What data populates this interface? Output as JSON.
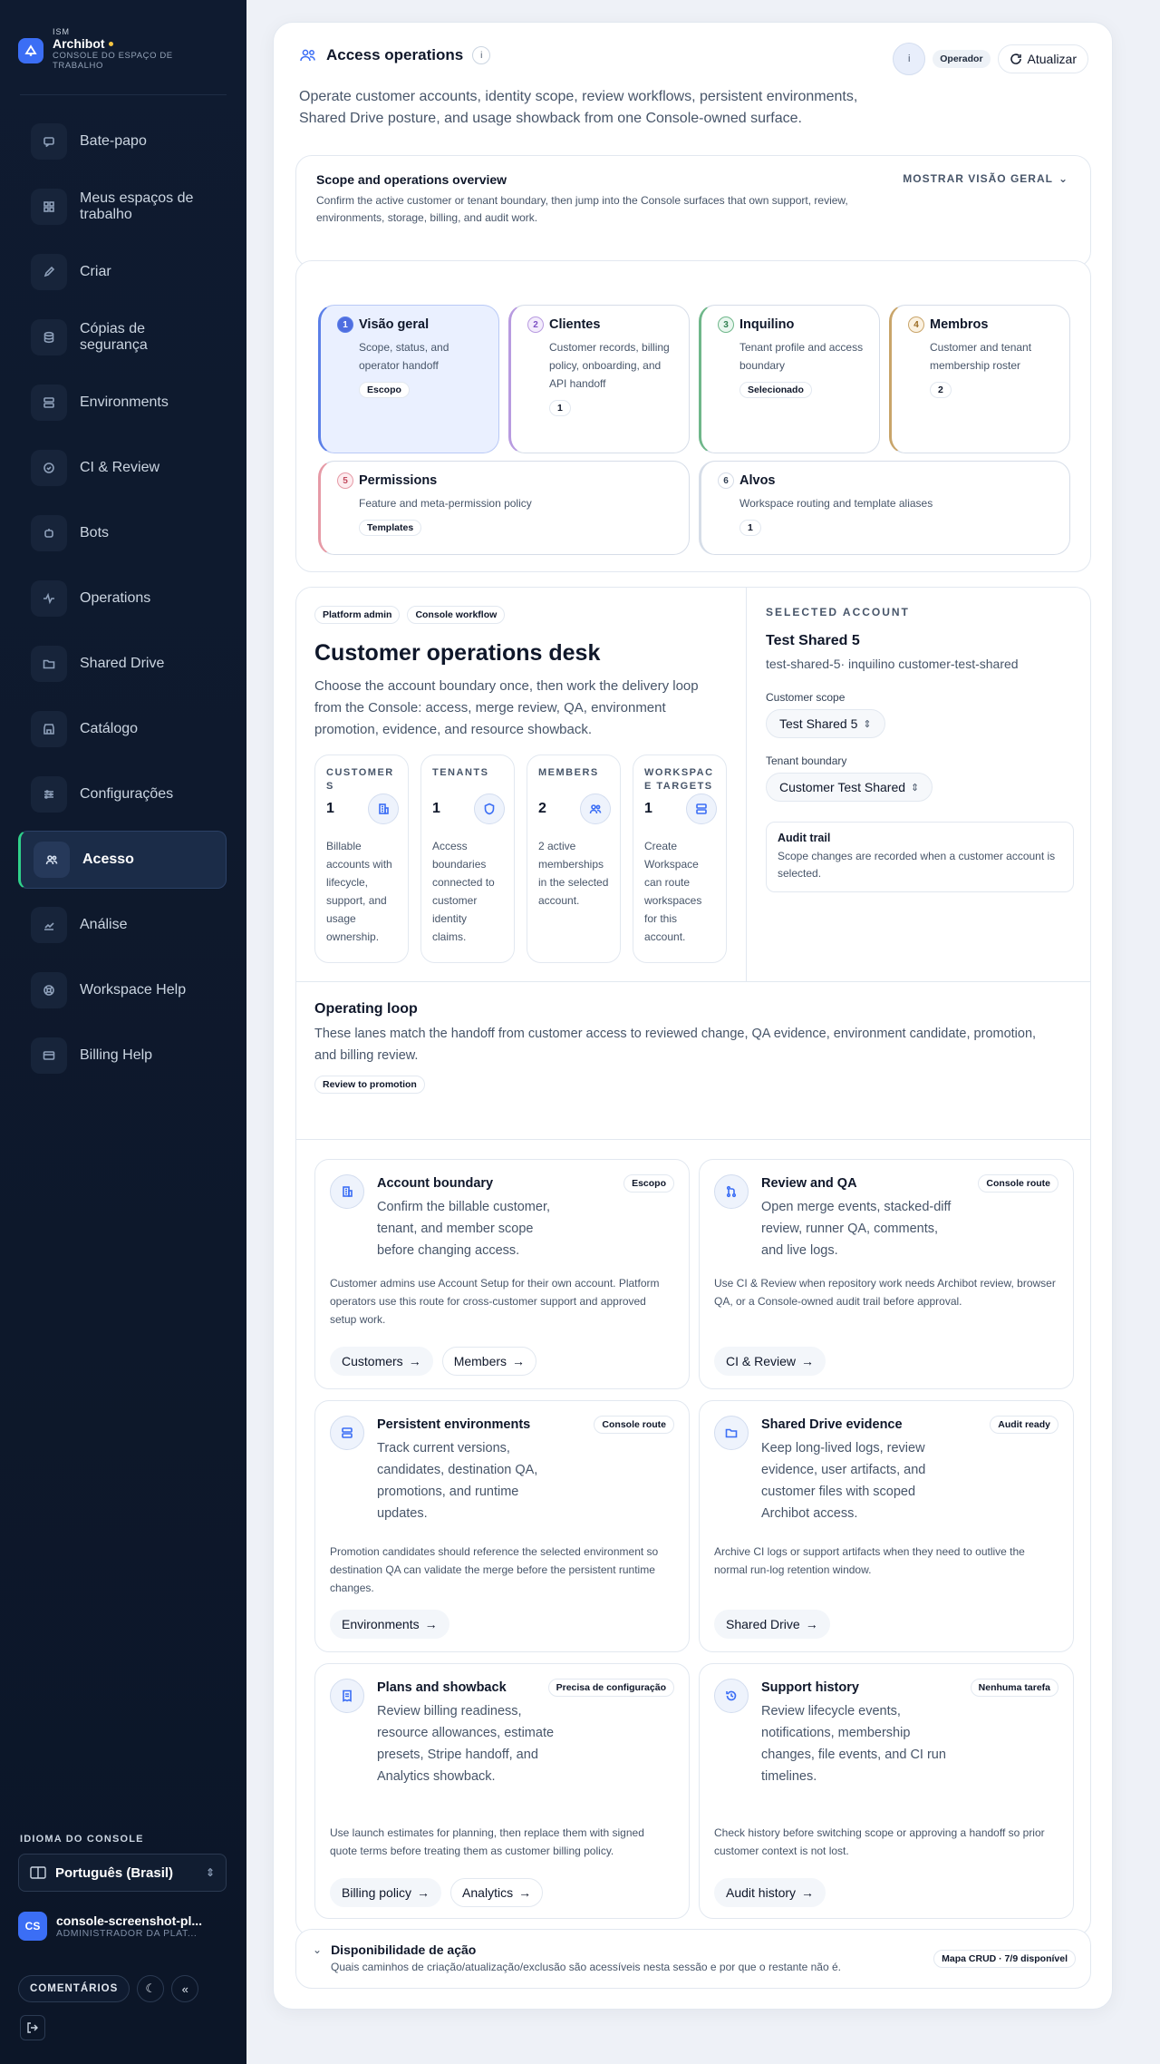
{
  "sidebar": {
    "brand_small": "ISM",
    "brand_name": "Archibot",
    "brand_sub": "CONSOLE DO ESPAÇO DE TRABALHO",
    "items": [
      {
        "label": "Bate-papo",
        "icon": "chat-icon"
      },
      {
        "label": "Meus espaços de trabalho",
        "icon": "grid-icon"
      },
      {
        "label": "Criar",
        "icon": "pencil-icon"
      },
      {
        "label": "Cópias de segurança",
        "icon": "database-icon"
      },
      {
        "label": "Environments",
        "icon": "server-icon"
      },
      {
        "label": "CI & Review",
        "icon": "check-circle-icon"
      },
      {
        "label": "Bots",
        "icon": "bot-icon"
      },
      {
        "label": "Operations",
        "icon": "pulse-icon"
      },
      {
        "label": "Shared Drive",
        "icon": "folder-icon"
      },
      {
        "label": "Catálogo",
        "icon": "store-icon"
      },
      {
        "label": "Configurações",
        "icon": "sliders-icon"
      },
      {
        "label": "Acesso",
        "icon": "users-icon",
        "active": true
      },
      {
        "label": "Análise",
        "icon": "chart-icon"
      },
      {
        "label": "Workspace Help",
        "icon": "lifebuoy-icon"
      },
      {
        "label": "Billing Help",
        "icon": "card-icon"
      }
    ],
    "lang_label": "IDIOMA DO CONSOLE",
    "lang_value": "Português (Brasil)",
    "user_initials": "CS",
    "user_name": "console-screenshot-pl...",
    "user_role": "ADMINISTRADOR DA PLAT...",
    "feedback": "COMENTÁRIOS",
    "accent": "#2fd18b"
  },
  "header": {
    "title": "Access operations",
    "info": "i",
    "avatar_letter": "i",
    "role_chip": "Operador",
    "refresh": "Atualizar",
    "intro": "Operate customer accounts, identity scope, review workflows, persistent environments, Shared Drive posture, and usage showback from one Console-owned surface."
  },
  "overview": {
    "title": "Scope and operations overview",
    "desc": "Confirm the active customer or tenant boundary, then jump into the Console surfaces that own support, review, environments, storage, billing, and audit work.",
    "toggle": "MOSTRAR VISÃO GERAL"
  },
  "steps": [
    {
      "num": "1",
      "title": "Visão geral",
      "desc": "Scope, status, and operator handoff",
      "badge": "Escopo"
    },
    {
      "num": "2",
      "title": "Clientes",
      "desc": "Customer records, billing policy, onboarding, and API handoff",
      "badge": "1"
    },
    {
      "num": "3",
      "title": "Inquilino",
      "desc": "Tenant profile and access boundary",
      "badge": "Selecionado"
    },
    {
      "num": "4",
      "title": "Membros",
      "desc": "Customer and tenant membership roster",
      "badge": "2"
    },
    {
      "num": "5",
      "title": "Permissions",
      "desc": "Feature and meta-permission policy",
      "badge": "Templates"
    },
    {
      "num": "6",
      "title": "Alvos",
      "desc": "Workspace routing and template aliases",
      "badge": "1"
    }
  ],
  "desk": {
    "chip1": "Platform admin",
    "chip2": "Console workflow",
    "title": "Customer operations desk",
    "desc": "Choose the account boundary once, then work the delivery loop from the Console: access, merge review, QA, environment promotion, evidence, and resource showback.",
    "stats": [
      {
        "label": "CUSTOMERS",
        "value": "1",
        "desc": "Billable accounts with lifecycle, support, and usage ownership."
      },
      {
        "label": "TENANTS",
        "value": "1",
        "desc": "Access boundaries connected to customer identity claims."
      },
      {
        "label": "MEMBERS",
        "value": "2",
        "desc": "2 active memberships in the selected account."
      },
      {
        "label": "WORKSPACE TARGETS",
        "value": "1",
        "desc": "Create Workspace can route workspaces for this account."
      }
    ]
  },
  "selected": {
    "label": "SELECTED ACCOUNT",
    "name": "Test Shared 5",
    "sub": "test-shared-5· inquilino customer-test-shared",
    "scope_label": "Customer scope",
    "scope_value": "Test Shared 5",
    "tenant_label": "Tenant boundary",
    "tenant_value": "Customer Test Shared",
    "audit_title": "Audit trail",
    "audit_desc": "Scope changes are recorded when a customer account is selected."
  },
  "loop": {
    "title": "Operating loop",
    "desc": "These lanes match the handoff from customer access to reviewed change, QA evidence, environment candidate, promotion, and billing review.",
    "chip": "Review to promotion"
  },
  "lanes": [
    {
      "title": "Account boundary",
      "badge": "Escopo",
      "desc": "Confirm the billable customer, tenant, and member scope before changing access.",
      "extra": "Customer admins use Account Setup for their own account. Platform operators use this route for cross-customer support and approved setup work.",
      "buttons": [
        "Customers",
        "Members"
      ]
    },
    {
      "title": "Review and QA",
      "badge": "Console route",
      "desc": "Open merge events, stacked-diff review, runner QA, comments, and live logs.",
      "extra": "Use CI & Review when repository work needs Archibot review, browser QA, or a Console-owned audit trail before approval.",
      "buttons": [
        "CI & Review"
      ]
    },
    {
      "title": "Persistent environments",
      "badge": "Console route",
      "desc": "Track current versions, candidates, destination QA, promotions, and runtime updates.",
      "extra": "Promotion candidates should reference the selected environment so destination QA can validate the merge before the persistent runtime changes.",
      "buttons": [
        "Environments"
      ]
    },
    {
      "title": "Shared Drive evidence",
      "badge": "Audit ready",
      "desc": "Keep long-lived logs, review evidence, user artifacts, and customer files with scoped Archibot access.",
      "extra": "Archive CI logs or support artifacts when they need to outlive the normal run-log retention window.",
      "buttons": [
        "Shared Drive"
      ]
    },
    {
      "title": "Plans and showback",
      "badge": "Precisa de configuração",
      "desc": "Review billing readiness, resource allowances, estimate presets, Stripe handoff, and Analytics showback.",
      "extra": "Use launch estimates for planning, then replace them with signed quote terms before treating them as customer billing policy.",
      "buttons": [
        "Billing policy",
        "Analytics"
      ]
    },
    {
      "title": "Support history",
      "badge": "Nenhuma tarefa",
      "desc": "Review lifecycle events, notifications, membership changes, file events, and CI run timelines.",
      "extra": "Check history before switching scope or approving a handoff so prior customer context is not lost.",
      "buttons": [
        "Audit history"
      ]
    }
  ],
  "availability": {
    "title": "Disponibilidade de ação",
    "desc": "Quais caminhos de criação/atualização/exclusão são acessíveis nesta sessão e por que o restante não é.",
    "chip": "Mapa CRUD · 7/9 disponível"
  }
}
